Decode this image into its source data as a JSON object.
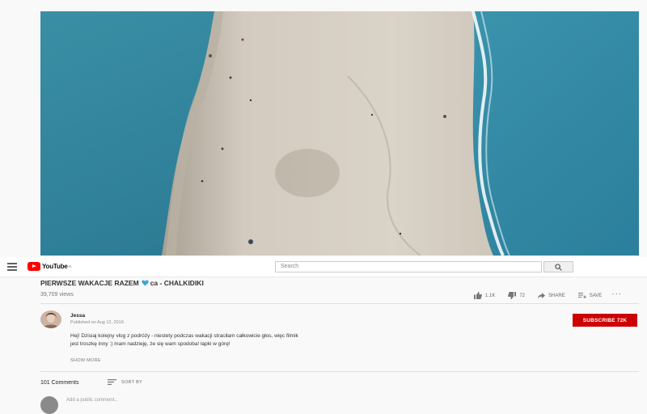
{
  "masthead": {
    "logo_text": "YouTube",
    "logo_sup": "PL",
    "search_placeholder": "Search"
  },
  "video": {
    "title_part1": "PIERWSZE WAKACJE RAZEM",
    "title_part2": "ca - CHALKIDIKI",
    "views": "39,709 views",
    "likes": "1.1K",
    "dislikes": "72",
    "share_label": "SHARE",
    "save_label": "SAVE",
    "more_label": "···"
  },
  "channel": {
    "name": "Jessa",
    "published": "Published on Aug 12, 2019",
    "subscribe_label": "SUBSCRIBE  72K"
  },
  "description": {
    "line1": "Hej! Dzisiaj kolejny vlog z podróży - niestety podczas wakacji straciłam całkowicie głos, więc filmik",
    "line2": "jest troszkę inny :) mam nadzieję, że się wam spodoba! łapki w górę!",
    "show_more": "SHOW MORE"
  },
  "comments": {
    "count": "101 Comments",
    "sort_label": "SORT BY",
    "add_placeholder": "Add a public comment..."
  },
  "colors": {
    "subscribe": "#cc0000",
    "logo_red": "#ff0000",
    "heart": "#3aa6d8"
  },
  "icons": [
    "menu-icon",
    "youtube-logo-icon",
    "search-icon",
    "like-icon",
    "dislike-icon",
    "share-icon",
    "save-icon",
    "more-icon",
    "heart-icon",
    "sort-icon"
  ]
}
